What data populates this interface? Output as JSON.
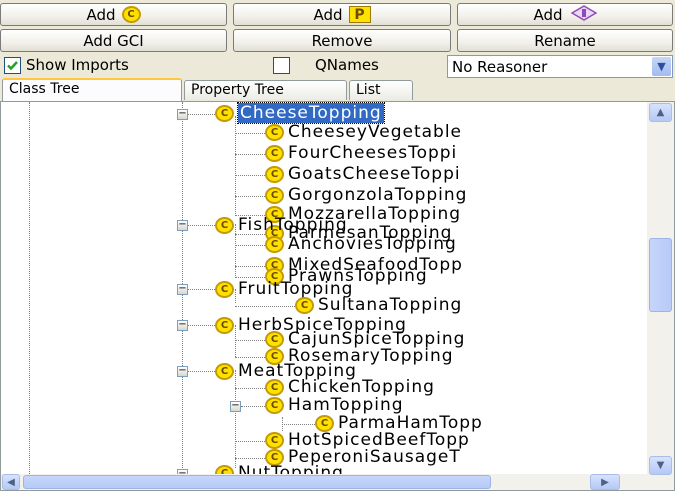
{
  "toolbar": {
    "add_class_label": "Add",
    "add_class_badge": "C",
    "add_property_label": "Add",
    "add_property_badge": "P",
    "add_individual_label": "Add",
    "add_gci_label": "Add GCI",
    "remove_label": "Remove",
    "rename_label": "Rename"
  },
  "options": {
    "show_imports_label": "Show Imports",
    "show_imports_checked": true,
    "qnames_label": "QNames",
    "qnames_checked": false,
    "reasoner_selected": "No Reasoner"
  },
  "tabs": [
    {
      "label": "Class Tree",
      "active": true
    },
    {
      "label": "Property Tree",
      "active": false
    },
    {
      "label": "List",
      "active": false
    }
  ],
  "tree": {
    "class_icon_letter": "C",
    "cheese_topping": "CheeseTopping",
    "cheesey_vegetable": "CheeseyVegetable",
    "four_cheeses": "FourCheesesToppi",
    "goats_cheese": "GoatsCheeseToppi",
    "gorgonzola": "GorgonzolaTopping",
    "mozzarella": "MozzarellaTopping",
    "parmesan": "ParmesanTopping",
    "fish_topping": "FishTopping",
    "anchovies": "AnchoviesTopping",
    "mixed_seafood": "MixedSeafoodTopp",
    "prawns": "PrawnsTopping",
    "fruit_topping": "FruitTopping",
    "sultana": "SultanaTopping",
    "herb_spice": "HerbSpiceTopping",
    "cajun_spice": "CajunSpiceTopping",
    "rosemary": "RosemaryTopping",
    "meat_topping": "MeatTopping",
    "chicken": "ChickenTopping",
    "ham": "HamTopping",
    "parma_ham": "ParmaHamTopp",
    "hot_spiced_beef": "HotSpicedBeefTopp",
    "peperoni_sausage": "PeperoniSausageT",
    "nut_topping": "NutTopping",
    "selected_node": "CheeseTopping"
  },
  "colors": {
    "selection": "#316ac5",
    "class_icon_fill": "#ffe100",
    "tab_highlight": "#ffc73c"
  }
}
